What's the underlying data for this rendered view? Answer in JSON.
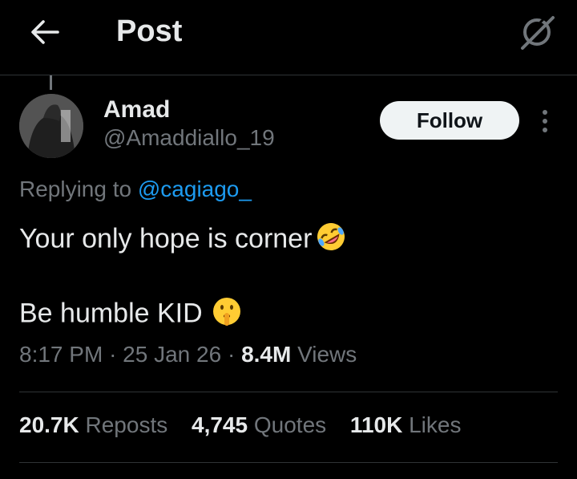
{
  "header": {
    "title": "Post",
    "back_icon": "arrow-left-icon",
    "grok_icon": "grok-spark-icon"
  },
  "post": {
    "author_name": "Amad",
    "author_handle": "@Amaddiallo_19",
    "follow_label": "Follow",
    "more_icon": "more-vertical-icon",
    "replying_prefix": "Replying to",
    "replying_handle": "@cagiago_",
    "text_line1": "Your only hope is corner",
    "emoji1": "rolling-on-floor-laughing-emoji",
    "text_line2": "Be humble KID",
    "emoji2": "shushing-face-emoji",
    "time": "8:17 PM",
    "separator": "·",
    "date": "25 Jan 26",
    "views_count": "8.4M",
    "views_label": "Views"
  },
  "stats": {
    "reposts_count": "20.7K",
    "reposts_label": "Reposts",
    "quotes_count": "4,745",
    "quotes_label": "Quotes",
    "likes_count": "110K",
    "likes_label": "Likes"
  },
  "colors": {
    "background": "#000000",
    "text": "#e7e9ea",
    "muted": "#71767b",
    "link": "#1d9bf0",
    "follow_bg": "#eff3f4"
  }
}
